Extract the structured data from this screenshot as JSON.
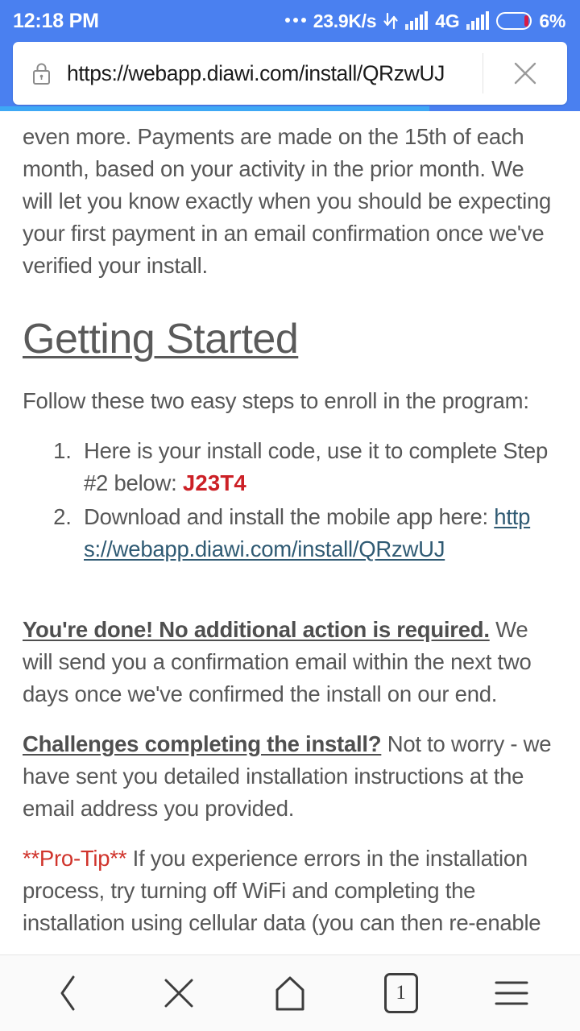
{
  "status_bar": {
    "clock": "12:18 PM",
    "network_speed": "23.9K/s",
    "network_type": "4G",
    "battery_percent": "6%",
    "battery_level": 6,
    "icons": [
      "more-dots-icon",
      "data-transfer-icon",
      "signal-bars-icon",
      "signal-bars-icon",
      "battery-icon"
    ]
  },
  "url_bar": {
    "url": "https://webapp.diawi.com/install/QRzwUJ",
    "secure_icon": "lock-icon",
    "close_icon": "close-icon",
    "progress_percent": 74
  },
  "page": {
    "paragraph_top": "even more. Payments are made on the 15th of each month, based on your activity in the prior month. We will let you know exactly when you should be expecting your first payment in an email confirmation once we've verified your install.",
    "heading": "Getting Started",
    "lead": "Follow these two easy steps to enroll in the program:",
    "steps": [
      {
        "text_before": "Here is your install code, use it to complete Step #2 below: ",
        "code": "J23T4",
        "text_after": ""
      },
      {
        "text_before": "Download and install the mobile app here: ",
        "link": "https://webapp.diawi.com/install/QRzwUJ",
        "text_after": ""
      }
    ],
    "done_notice": {
      "emphasis": "You're done! No additional action is required.",
      "body": " We will send you a confirmation email within the next two days once we've confirmed the install on our end."
    },
    "challenges_notice": {
      "emphasis": "Challenges completing the install?",
      "body": " Not to worry - we have sent you detailed installation instructions at the email address you provided."
    },
    "pro_tip": {
      "emphasis": "**Pro-Tip**",
      "body": " If you experience errors in the installation process, try turning off WiFi and completing the installation using cellular data (you can then re-enable"
    }
  },
  "bottom_nav": {
    "back_label": "back-chevron-icon",
    "close_label": "close-icon",
    "home_label": "home-icon",
    "tabs_count": "1",
    "menu_label": "hamburger-menu-icon"
  },
  "colors": {
    "chrome_blue": "#4a80f0",
    "progress_blue": "#3ea8f5",
    "code_red": "#cc2026",
    "link_blue": "#2f5a73",
    "body_gray": "#575757",
    "battery_red": "#d81b45"
  }
}
